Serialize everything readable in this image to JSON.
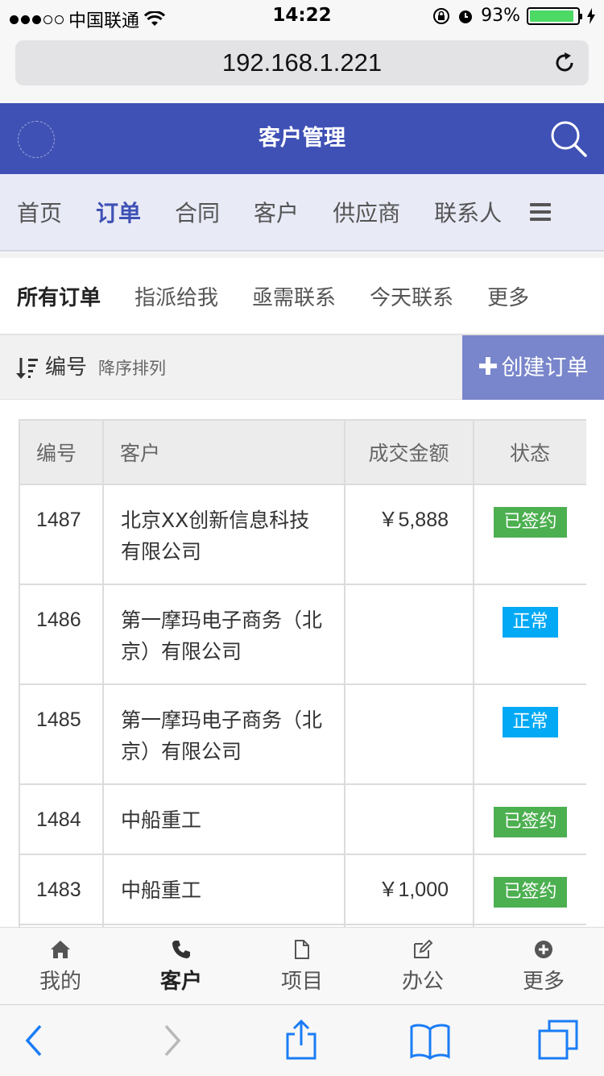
{
  "statusbar": {
    "carrier": "中国联通",
    "time": "14:22",
    "battery_percent": 93,
    "battery_text": "93%",
    "battery_color": "#4cd964"
  },
  "browser": {
    "url": "192.168.1.221"
  },
  "header": {
    "title": "客户管理",
    "bg_color": "#3f51b5"
  },
  "main_nav": {
    "items": [
      "首页",
      "订单",
      "合同",
      "客户",
      "供应商",
      "联系人"
    ],
    "active": "订单"
  },
  "sub_tabs": {
    "items": [
      "所有订单",
      "指派给我",
      "亟需联系",
      "今天联系",
      "更多"
    ],
    "active": "所有订单"
  },
  "sort": {
    "field": "编号",
    "order": "降序排列",
    "create_label": "创建订单"
  },
  "table": {
    "headers": [
      "编号",
      "客户",
      "成交金额",
      "状态"
    ],
    "rows": [
      {
        "id": "1487",
        "customer": "北京XX创新信息科技有限公司",
        "amount": "￥5,888",
        "status": "已签约",
        "status_type": "signed"
      },
      {
        "id": "1486",
        "customer": "第一摩玛电子商务（北京）有限公司",
        "amount": "",
        "status": "正常",
        "status_type": "normal"
      },
      {
        "id": "1485",
        "customer": "第一摩玛电子商务（北京）有限公司",
        "amount": "",
        "status": "正常",
        "status_type": "normal"
      },
      {
        "id": "1484",
        "customer": "中船重工",
        "amount": "",
        "status": "已签约",
        "status_type": "signed"
      },
      {
        "id": "1483",
        "customer": "中船重工",
        "amount": "￥1,000",
        "status": "已签约",
        "status_type": "signed"
      }
    ]
  },
  "bottom_tabs": {
    "items": [
      {
        "label": "我的",
        "icon": "home-icon"
      },
      {
        "label": "客户",
        "icon": "phone-icon"
      },
      {
        "label": "项目",
        "icon": "document-icon"
      },
      {
        "label": "办公",
        "icon": "edit-icon"
      },
      {
        "label": "更多",
        "icon": "plus-circle-icon"
      }
    ],
    "active": "客户"
  },
  "colors": {
    "accent": "#3f51b5",
    "create_button": "#7986cb",
    "signed": "#4caf50",
    "normal": "#03a9f4"
  }
}
